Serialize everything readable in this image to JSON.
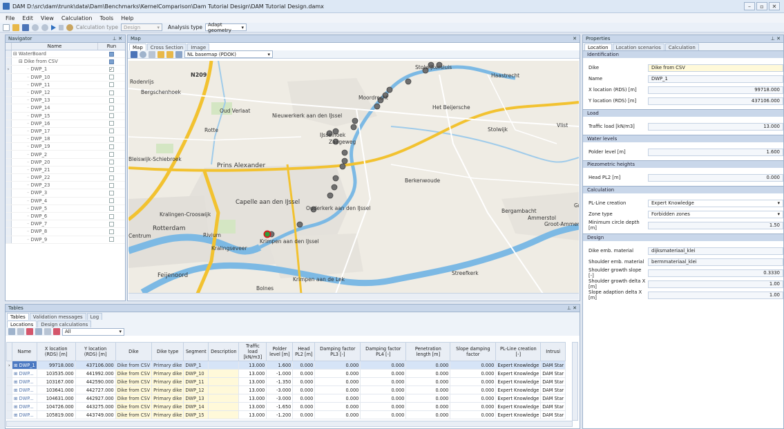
{
  "window": {
    "title": "DAM  D:\\src\\dam\\trunk\\data\\Dam\\Benchmarks\\KernelComparison\\Dam Tutorial Design\\DAM Tutorial Design.damx"
  },
  "menu": [
    "File",
    "Edit",
    "View",
    "Calculation",
    "Tools",
    "Help"
  ],
  "toolbar": {
    "calc_type_label": "Calculation type",
    "calc_type_value": "Design",
    "analysis_type_label": "Analysis type",
    "analysis_type_value": "Adapt geometry"
  },
  "navigator": {
    "title": "Navigator",
    "col_name": "Name",
    "col_run": "Run",
    "root": "WaterBoard",
    "group": "Dike from CSV",
    "items": [
      "DWP_1",
      "DWP_10",
      "DWP_11",
      "DWP_12",
      "DWP_13",
      "DWP_14",
      "DWP_15",
      "DWP_16",
      "DWP_17",
      "DWP_18",
      "DWP_19",
      "DWP_2",
      "DWP_20",
      "DWP_21",
      "DWP_22",
      "DWP_23",
      "DWP_3",
      "DWP_4",
      "DWP_5",
      "DWP_6",
      "DWP_7",
      "DWP_8",
      "DWP_9"
    ],
    "checked": [
      "DWP_1"
    ]
  },
  "map": {
    "title": "Map",
    "tabs": [
      "Map",
      "Cross Section",
      "Image"
    ],
    "basemap": "NL basemap (PDOK)",
    "labels": [
      {
        "text": "Stolwijkersluis"
      },
      {
        "text": "Haastrecht"
      },
      {
        "text": "N209"
      },
      {
        "text": "Rodenrijs"
      },
      {
        "text": "Bergschenhoek"
      },
      {
        "text": "Moordrecht"
      },
      {
        "text": "Het Beijersche"
      },
      {
        "text": "Oud Verlaat"
      },
      {
        "text": "Nieuwerkerk aan den IJssel"
      },
      {
        "text": "Stolwijk"
      },
      {
        "text": "Vlist"
      },
      {
        "text": "Rotte"
      },
      {
        "text": "IJsselhoek"
      },
      {
        "text": "Zaageweg"
      },
      {
        "text": "Bleiswijk-Schiebroek"
      },
      {
        "text": "Prins Alexander"
      },
      {
        "text": "Berkenwoude"
      },
      {
        "text": "Capelle aan den IJssel"
      },
      {
        "text": "Ouderkerk aan den IJssel"
      },
      {
        "text": "Bergambacht"
      },
      {
        "text": "Ammerstol"
      },
      {
        "text": "Groot-Ammers"
      },
      {
        "text": "Gr"
      },
      {
        "text": "Kralingen-Crooswijk"
      },
      {
        "text": "Rotterdam"
      },
      {
        "text": "Rivium"
      },
      {
        "text": "Krimpen aan den IJssel"
      },
      {
        "text": "Centrum"
      },
      {
        "text": "Kralingseveer"
      },
      {
        "text": "Feijenoord"
      },
      {
        "text": "Streefkerk"
      },
      {
        "text": "Krimpen aan de Lek"
      },
      {
        "text": "Bolnes"
      }
    ]
  },
  "properties": {
    "title": "Properties",
    "tabs": [
      "Location",
      "Location scenarios",
      "Calculation"
    ],
    "sections": [
      {
        "title": "Identification",
        "rows": [
          {
            "label": "Dike",
            "value": "Dike from CSV",
            "style": "y"
          },
          {
            "label": "Name",
            "value": "DWP_1",
            "style": ""
          },
          {
            "label": "X location (RDS) [m]",
            "value": "99718.000",
            "style": "r"
          },
          {
            "label": "Y location (RDS) [m]",
            "value": "437106.000",
            "style": "r"
          }
        ]
      },
      {
        "title": "Load",
        "rows": [
          {
            "label": "Traffic load [kN/m3]",
            "value": "13.000",
            "style": "r"
          }
        ]
      },
      {
        "title": "Water levels",
        "rows": [
          {
            "label": "Polder level [m]",
            "value": "1.600",
            "style": "r"
          }
        ]
      },
      {
        "title": "Piezometric heights",
        "rows": [
          {
            "label": "Head PL2 [m]",
            "value": "0.000",
            "style": "r"
          }
        ]
      },
      {
        "title": "Calculation",
        "rows": [
          {
            "label": "PL-Line creation",
            "value": "Expert Knowledge",
            "style": "sel"
          },
          {
            "label": "Zone type",
            "value": "Forbidden zones",
            "style": "sel o"
          },
          {
            "label": "Minimum circle depth [m]",
            "value": "1.50",
            "style": "r"
          }
        ]
      },
      {
        "title": "Design",
        "rows": [
          {
            "label": "Dike emb. material",
            "value": "dijksmateriaal_klei",
            "style": ""
          },
          {
            "label": "Shoulder emb. material",
            "value": "bermmateriaal_klei",
            "style": ""
          },
          {
            "label": "Shoulder growth slope [-]",
            "value": "0.3330",
            "style": "r"
          },
          {
            "label": "Shoulder growth delta X [m]",
            "value": "1.00",
            "style": "r"
          },
          {
            "label": "Slope adaption delta X [m]",
            "value": "1.00",
            "style": "r"
          }
        ]
      }
    ]
  },
  "tables": {
    "title": "Tables",
    "tabs": [
      "Tables",
      "Validation messages",
      "Log"
    ],
    "subtabs": [
      "Locations",
      "Design calculations"
    ],
    "filter": "All",
    "columns": [
      "Name",
      "X location (RDS) [m]",
      "Y location (RDS) [m]",
      "Dike",
      "Dike type",
      "Segment",
      "Description",
      "Traffic load [kN/m3]",
      "Polder level [m]",
      "Head PL2 [m]",
      "Damping factor PL3 [-]",
      "Damping factor PL4 [-]",
      "Penetration length [m]",
      "Slope damping factor",
      "PL-Line creation [-]",
      "Intrusi"
    ],
    "rows": [
      [
        "DWP_1",
        "99718.000",
        "437106.000",
        "Dike from CSV",
        "Primary dike",
        "DWP_1",
        "",
        "13.000",
        "1.600",
        "0.000",
        "0.000",
        "0.000",
        "0.000",
        "0.000",
        "Expert Knowledge",
        "DAM Star"
      ],
      [
        "DWP...",
        "103535.000",
        "441992.000",
        "Dike from CSV",
        "Primary dike",
        "DWP_10",
        "",
        "13.000",
        "-1.000",
        "0.000",
        "0.000",
        "0.000",
        "0.000",
        "0.000",
        "Expert Knowledge",
        "DAM Star"
      ],
      [
        "DWP...",
        "103167.000",
        "442590.000",
        "Dike from CSV",
        "Primary dike",
        "DWP_11",
        "",
        "13.000",
        "-1.350",
        "0.000",
        "0.000",
        "0.000",
        "0.000",
        "0.000",
        "Expert Knowledge",
        "DAM Star"
      ],
      [
        "DWP...",
        "103641.000",
        "442727.000",
        "Dike from CSV",
        "Primary dike",
        "DWP_12",
        "",
        "13.000",
        "-3.000",
        "0.000",
        "0.000",
        "0.000",
        "0.000",
        "0.000",
        "Expert Knowledge",
        "DAM Star"
      ],
      [
        "DWP...",
        "104631.000",
        "442927.000",
        "Dike from CSV",
        "Primary dike",
        "DWP_13",
        "",
        "13.000",
        "-3.000",
        "0.000",
        "0.000",
        "0.000",
        "0.000",
        "0.000",
        "Expert Knowledge",
        "DAM Star"
      ],
      [
        "DWP...",
        "104726.000",
        "443275.000",
        "Dike from CSV",
        "Primary dike",
        "DWP_14",
        "",
        "13.000",
        "-1.650",
        "0.000",
        "0.000",
        "0.000",
        "0.000",
        "0.000",
        "Expert Knowledge",
        "DAM Star"
      ],
      [
        "DWP...",
        "105819.000",
        "443749.000",
        "Dike from CSV",
        "Primary dike",
        "DWP_15",
        "",
        "13.000",
        "-1.200",
        "0.000",
        "0.000",
        "0.000",
        "0.000",
        "0.000",
        "Expert Knowledge",
        "DAM Star"
      ]
    ]
  },
  "colors": {
    "accent": "#4a78c2",
    "panel_header": "#c9d7ea",
    "water": "#79b7e3",
    "highway": "#f2c230",
    "road": "#ffffff",
    "urban": "#e3e0da"
  }
}
